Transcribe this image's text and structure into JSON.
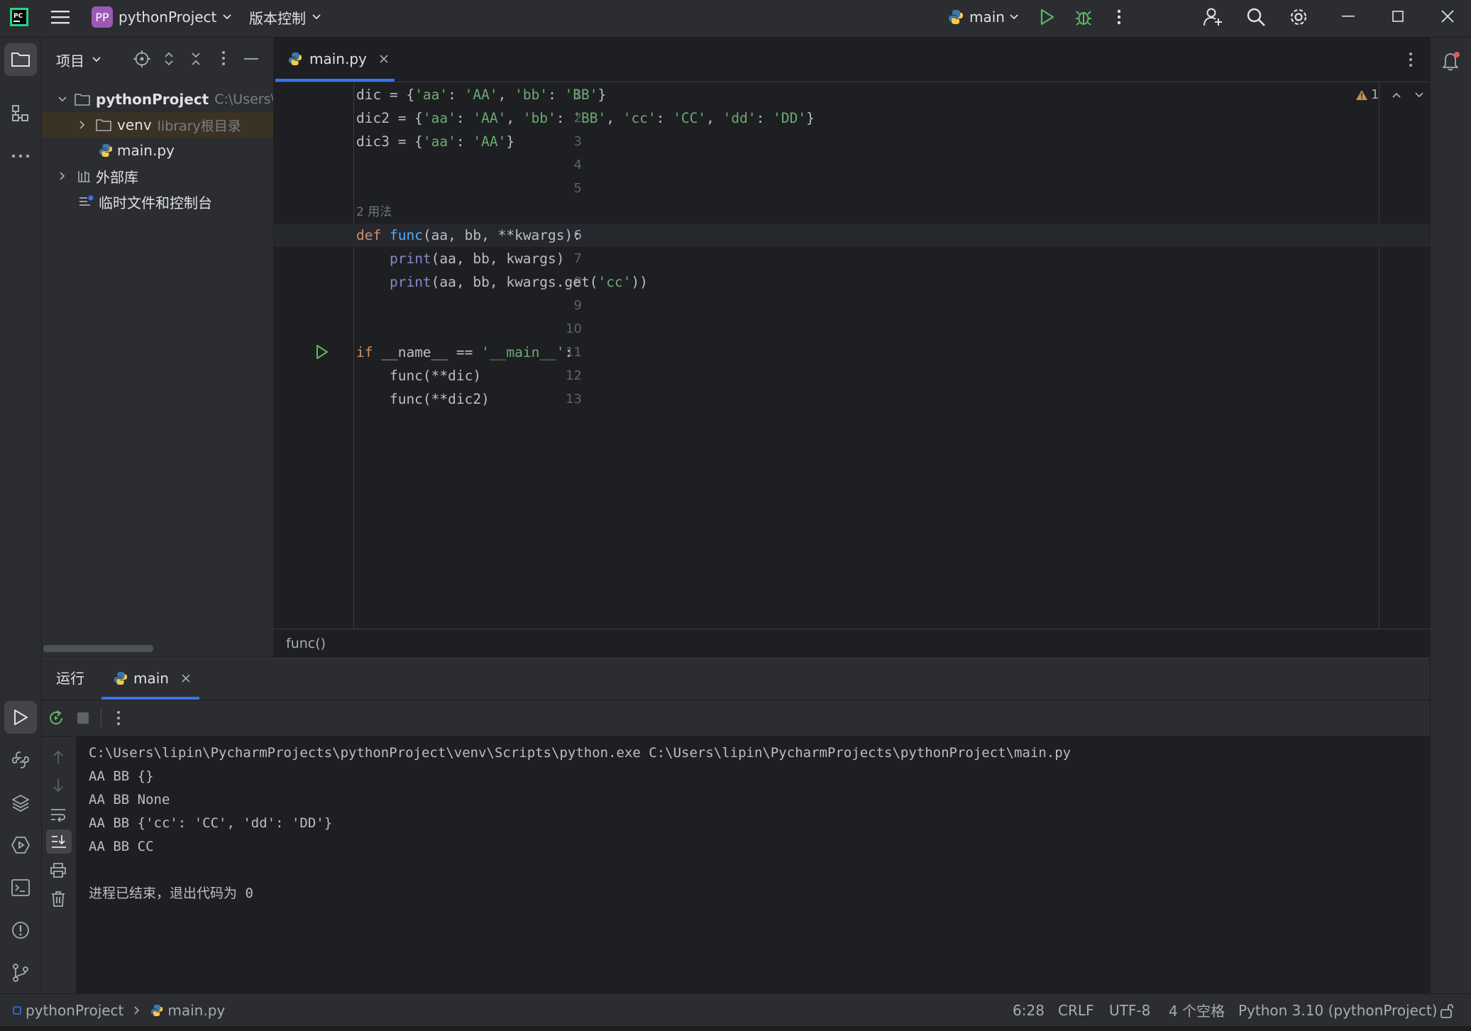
{
  "titlebar": {
    "project_badge": "PP",
    "project_name": "pythonProject",
    "vcs_menu": "版本控制",
    "run_config": "main"
  },
  "project_panel": {
    "title": "项目",
    "tree": [
      {
        "label": "pythonProject",
        "hint": "C:\\Users\\li"
      },
      {
        "label": "venv",
        "hint": "library根目录"
      },
      {
        "label": "main.py",
        "hint": ""
      },
      {
        "label": "外部库",
        "hint": ""
      },
      {
        "label": "临时文件和控制台",
        "hint": ""
      }
    ]
  },
  "editor": {
    "tab_label": "main.py",
    "warning_count": "1",
    "usages_hint": "2 用法",
    "breadcrumb": "func()",
    "line_numbers": [
      "1",
      "2",
      "3",
      "4",
      "5",
      "6",
      "7",
      "8",
      "9",
      "10",
      "11",
      "12",
      "13"
    ],
    "code": {
      "l1_a": "dic = {",
      "l1_b": "'aa'",
      "l1_c": ": ",
      "l1_d": "'AA'",
      "l1_e": ", ",
      "l1_f": "'bb'",
      "l1_g": ": ",
      "l1_h": "'BB'",
      "l1_i": "}",
      "l2_a": "dic2 = {",
      "l2_b": "'aa'",
      "l2_c": ": ",
      "l2_d": "'AA'",
      "l2_e": ", ",
      "l2_f": "'bb'",
      "l2_g": ": ",
      "l2_h": "'BB'",
      "l2_i": ", ",
      "l2_j": "'cc'",
      "l2_k": ": ",
      "l2_l": "'CC'",
      "l2_m": ", ",
      "l2_n": "'dd'",
      "l2_o": ": ",
      "l2_p": "'DD'",
      "l2_q": "}",
      "l3_a": "dic3 = {",
      "l3_b": "'aa'",
      "l3_c": ": ",
      "l3_d": "'AA'",
      "l3_e": "}",
      "l6_kw": "def ",
      "l6_fn": "func",
      "l6_rest": "(aa, bb, **kwargs):",
      "l7_indent": "    ",
      "l7_bi": "print",
      "l7_rest": "(aa, bb, kwargs)",
      "l8_indent": "    ",
      "l8_bi": "print",
      "l8_rest": "(aa, bb, kwargs.get(",
      "l8_str": "'cc'",
      "l8_end": "))",
      "l11_kw": "if ",
      "l11_rest": "__name__ == ",
      "l11_str": "'__main__'",
      "l11_end": ":",
      "l12": "    func(**dic)",
      "l13": "    func(**dic2)"
    }
  },
  "run_panel": {
    "title": "运行",
    "tab_label": "main",
    "console": [
      "C:\\Users\\lipin\\PycharmProjects\\pythonProject\\venv\\Scripts\\python.exe C:\\Users\\lipin\\PycharmProjects\\pythonProject\\main.py",
      "AA BB {}",
      "AA BB None",
      "AA BB {'cc': 'CC', 'dd': 'DD'}",
      "AA BB CC",
      "",
      "进程已结束，退出代码为 0"
    ]
  },
  "statusbar": {
    "crumb_project": "pythonProject",
    "crumb_file": "main.py",
    "position": "6:28",
    "line_sep": "CRLF",
    "encoding": "UTF-8",
    "indent": "4 个空格",
    "interpreter": "Python 3.10 (pythonProject)"
  },
  "colors": {
    "accent": "#3574f0",
    "keyword": "#cf8e6d",
    "function": "#56a8f5",
    "string": "#6aab73",
    "builtin": "#8888c6",
    "run_green": "#5fb865"
  }
}
